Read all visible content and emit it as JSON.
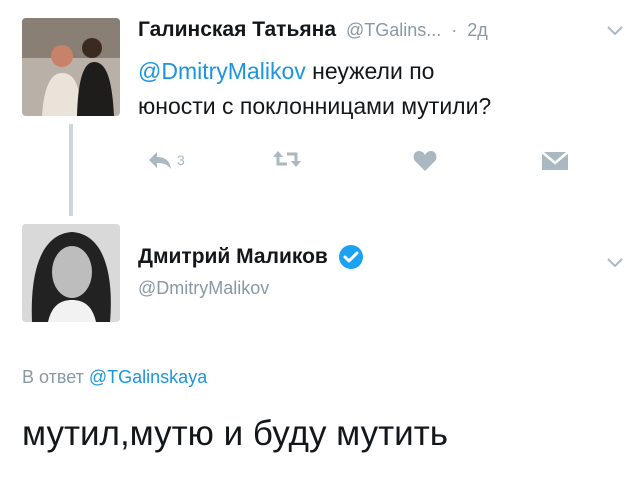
{
  "tweet1": {
    "author_name": "Галинская Татьяна",
    "handle": "@TGalins...",
    "separator": "·",
    "time": "2д",
    "mention": "@DmitryMalikov",
    "text_line1_rest": " неужели по",
    "text_line2": "юности с поклонницами мутили?",
    "actions": {
      "reply_count": "3"
    }
  },
  "tweet2": {
    "author_name": "Дмитрий Маликов",
    "handle": "@DmitryMalikov",
    "reply_prefix": "В ответ ",
    "reply_to": "@TGalinskaya",
    "text": "мутил,мутю и буду мутить"
  },
  "colors": {
    "link": "#1b95e0",
    "muted": "#8899a6",
    "icon": "#aab8c2",
    "verified": "#1da1f2",
    "thread_line": "#ccd6dd"
  },
  "icons": {
    "reply": "reply-icon",
    "retweet": "retweet-icon",
    "like": "heart-icon",
    "dm": "envelope-icon",
    "chevron": "chevron-down-icon",
    "verified": "verified-badge-icon"
  }
}
